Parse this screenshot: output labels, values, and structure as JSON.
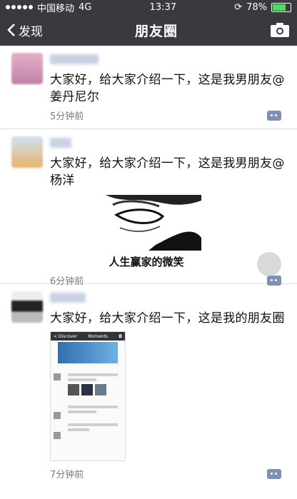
{
  "status_bar": {
    "carrier": "中国移动",
    "network": "4G",
    "time": "13:37",
    "battery": "78%"
  },
  "nav": {
    "back_label": "发现",
    "title": "朋友圈"
  },
  "posts": [
    {
      "text": "大家好，给大家介绍一下，这是我男朋友@姜丹尼尔",
      "time": "5分钟前"
    },
    {
      "text": "大家好，给大家介绍一下，这是我男朋友@杨洋",
      "meme_caption": "人生赢家的微笑",
      "time": "6分钟前"
    },
    {
      "text": "大家好，给大家介绍一下，这是我的朋友圈",
      "time": "7分钟前",
      "screenshot": {
        "back": "< Discover",
        "title": "Moments"
      }
    }
  ],
  "colors": {
    "nav_bg": "#393a3f",
    "comment_icon": "#7f90b1",
    "battery_fill": "#4cd964"
  }
}
